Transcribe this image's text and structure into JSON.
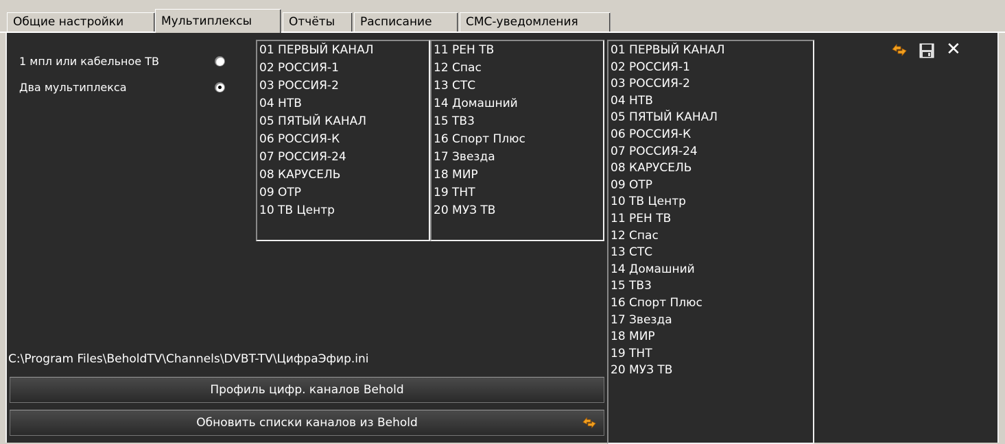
{
  "tabs": [
    {
      "label": "Общие настройки",
      "active": false
    },
    {
      "label": "Мультиплексы",
      "active": true
    },
    {
      "label": "Отчёты",
      "active": false
    },
    {
      "label": "Расписание",
      "active": false
    },
    {
      "label": "СМС-уведомления",
      "active": false
    }
  ],
  "options": {
    "single": {
      "label": "1 мпл или кабельное ТВ",
      "checked": false
    },
    "double": {
      "label": "Два мультиплекса",
      "checked": true
    }
  },
  "mux1": [
    "01 ПЕРВЫЙ КАНАЛ",
    "02 РОССИЯ-1",
    "03 РОССИЯ-2",
    "04 НТВ",
    "05 ПЯТЫЙ КАНАЛ",
    "06 РОССИЯ-К",
    "07 РОССИЯ-24",
    "08 КАРУСЕЛЬ",
    "09 ОТР",
    "10 ТВ Центр"
  ],
  "mux2": [
    "11 РЕН ТВ",
    "12 Спас",
    "13 СТС",
    "14 Домашний",
    "15 ТВ3",
    "16 Спорт Плюс",
    "17 Звезда",
    "18 МИР",
    "19 ТНТ",
    "20 МУЗ ТВ"
  ],
  "merged": [
    "01 ПЕРВЫЙ КАНАЛ",
    "02 РОССИЯ-1",
    "03 РОССИЯ-2",
    "04 НТВ",
    "05 ПЯТЫЙ КАНАЛ",
    "06 РОССИЯ-К",
    "07 РОССИЯ-24",
    "08 КАРУСЕЛЬ",
    "09 ОТР",
    "10 ТВ Центр",
    "11 РЕН ТВ",
    "12 Спас",
    "13 СТС",
    "14 Домашний",
    "15 ТВ3",
    "16 Спорт Плюс",
    "17 Звезда",
    "18 МИР",
    "19 ТНТ",
    "20 МУЗ ТВ"
  ],
  "profile_path": "C:\\Program Files\\BeholdTV\\Channels\\DVBT-TV\\ЦифраЭфир.ini",
  "buttons": {
    "profile": "Профиль цифр. каналов Behold",
    "update": "Обновить списки каналов из Behold"
  },
  "toolbar": {
    "refresh_icon": "refresh-arrows-icon",
    "save_icon": "floppy-disk-icon",
    "close_icon": "close-icon",
    "close_glyph": "✕"
  },
  "colors": {
    "panel_bg": "#2b2b2b",
    "icon_orange": "#f0a020"
  }
}
